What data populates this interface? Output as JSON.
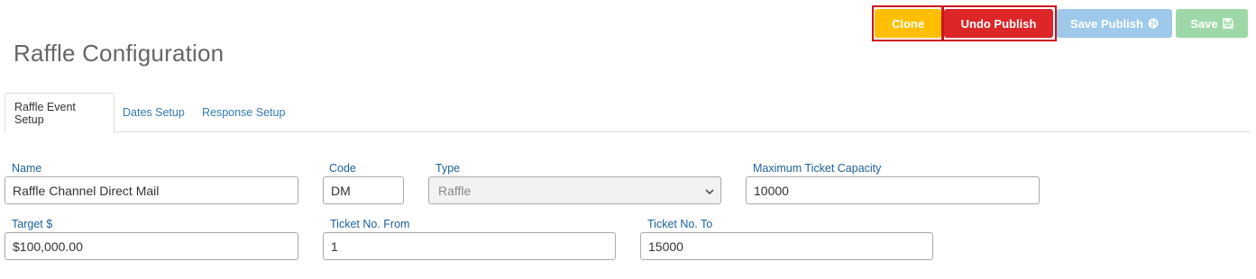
{
  "page": {
    "title": "Raffle Configuration"
  },
  "toolbar": {
    "clone_label": "Clone",
    "undo_publish_label": "Undo Publish",
    "save_publish_label": "Save Publish",
    "save_label": "Save",
    "colors": {
      "clone": "#ffbf00",
      "undo_publish": "#dc2628",
      "save_publish": "#9ec9ea",
      "save": "#9ed8a8",
      "focus_outline": "#d0121b"
    }
  },
  "tabs": [
    {
      "label": "Raffle Event Setup",
      "active": true
    },
    {
      "label": "Dates Setup",
      "active": false
    },
    {
      "label": "Response Setup",
      "active": false
    }
  ],
  "form": {
    "name": {
      "label": "Name",
      "value": "Raffle Channel Direct Mail"
    },
    "code": {
      "label": "Code",
      "value": "DM"
    },
    "type": {
      "label": "Type",
      "value": "Raffle",
      "disabled": true
    },
    "max_capacity": {
      "label": "Maximum Ticket Capacity",
      "value": "10000"
    },
    "target": {
      "label": "Target $",
      "value": "$100,000.00"
    },
    "ticket_from": {
      "label": "Ticket No. From",
      "value": "1"
    },
    "ticket_to": {
      "label": "Ticket No. To",
      "value": "15000"
    }
  },
  "icons": {
    "save_publish": "globe-icon",
    "save": "floppy-disk-icon",
    "type_select": "chevron-down-icon"
  }
}
